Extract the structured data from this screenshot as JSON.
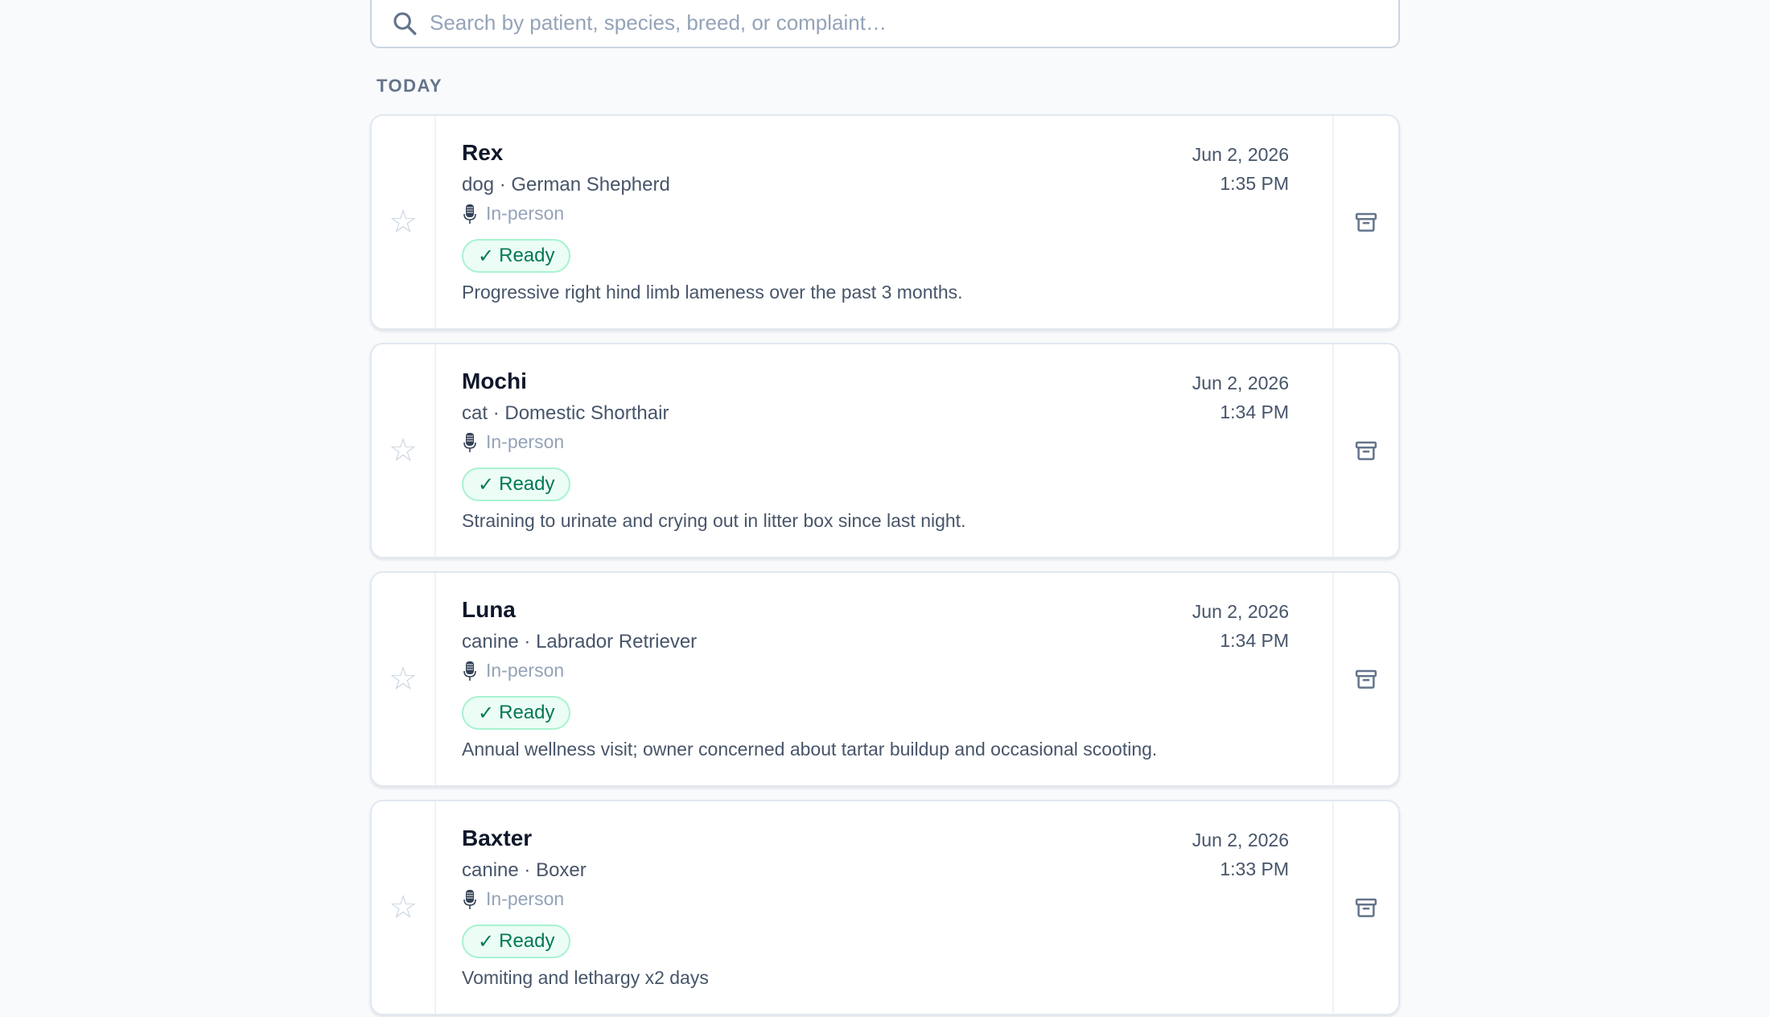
{
  "search": {
    "placeholder": "Search by patient, species, breed, or complaint…",
    "value": ""
  },
  "section": {
    "label": "TODAY"
  },
  "icons": {
    "search": "search-icon",
    "favorite": "star-icon",
    "mode": "microphone-icon",
    "archive": "archive-icon"
  },
  "colors": {
    "ready_bg": "#ecfdf5",
    "ready_border": "#a7f3d0",
    "ready_text": "#047857"
  },
  "visits": [
    {
      "name": "Rex",
      "species": "dog",
      "separator": "·",
      "breed": "German Shepherd",
      "mode": "In-person",
      "status_check": "✓",
      "status": "Ready",
      "complaint": "Progressive right hind limb lameness over the past 3 months.",
      "date": "Jun 2, 2026",
      "time": "1:35 PM",
      "star": "☆"
    },
    {
      "name": "Mochi",
      "species": "cat",
      "separator": "·",
      "breed": "Domestic Shorthair",
      "mode": "In-person",
      "status_check": "✓",
      "status": "Ready",
      "complaint": "Straining to urinate and crying out in litter box since last night.",
      "date": "Jun 2, 2026",
      "time": "1:34 PM",
      "star": "☆"
    },
    {
      "name": "Luna",
      "species": "canine",
      "separator": "·",
      "breed": "Labrador Retriever",
      "mode": "In-person",
      "status_check": "✓",
      "status": "Ready",
      "complaint": "Annual wellness visit; owner concerned about tartar buildup and occasional scooting.",
      "date": "Jun 2, 2026",
      "time": "1:34 PM",
      "star": "☆"
    },
    {
      "name": "Baxter",
      "species": "canine",
      "separator": "·",
      "breed": "Boxer",
      "mode": "In-person",
      "status_check": "✓",
      "status": "Ready",
      "complaint": "Vomiting and lethargy x2 days",
      "date": "Jun 2, 2026",
      "time": "1:33 PM",
      "star": "☆"
    }
  ]
}
